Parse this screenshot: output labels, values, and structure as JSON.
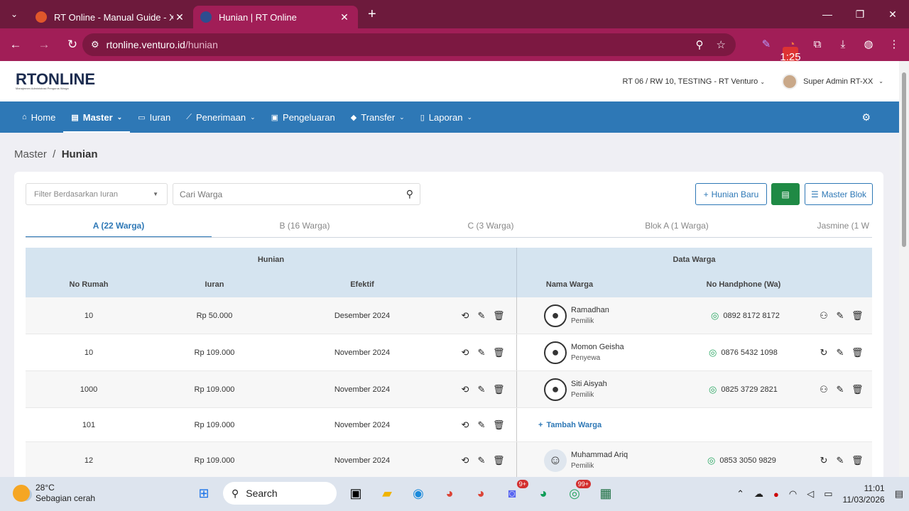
{
  "browser": {
    "tabs": [
      {
        "title": "RT Online - Manual Guide - Xm",
        "active": false
      },
      {
        "title": "Hunian | RT Online",
        "active": true
      }
    ],
    "url_host": "rtonline.venturo.id",
    "url_path": "/hunian",
    "ext_badge": "1:25"
  },
  "app": {
    "logo_main": "RT",
    "logo_on": "ONLINE",
    "logo_sub": "Manajemen Administrasi Pengurus Warga",
    "org_select": "RT 06 / RW 10, TESTING - RT Venturo",
    "user_name": "Super Admin RT-XX"
  },
  "menu": [
    {
      "label": "Home",
      "icon": "home-icon",
      "chev": false
    },
    {
      "label": "Master",
      "icon": "file-icon",
      "chev": true,
      "active": true
    },
    {
      "label": "Iuran",
      "icon": "card-icon",
      "chev": false
    },
    {
      "label": "Penerimaan",
      "icon": "chart-icon",
      "chev": true
    },
    {
      "label": "Pengeluaran",
      "icon": "receipt-icon",
      "chev": false
    },
    {
      "label": "Transfer",
      "icon": "tag-icon",
      "chev": true
    },
    {
      "label": "Laporan",
      "icon": "doc-icon",
      "chev": true
    }
  ],
  "breadcrumb": {
    "parent": "Master",
    "current": "Hunian"
  },
  "toolbar": {
    "filter_placeholder": "Filter Berdasarkan Iuran",
    "search_placeholder": "Cari Warga",
    "new_button": "Hunian Baru",
    "master_blok_button": "Master Blok"
  },
  "blok_tabs": [
    "A (22 Warga)",
    "B (16 Warga)",
    "C (3 Warga)",
    "Blok A (1 Warga)",
    "Jasmine (1 W"
  ],
  "table": {
    "group_hunian": "Hunian",
    "group_warga": "Data Warga",
    "col_no": "No Rumah",
    "col_iuran": "Iuran",
    "col_efektif": "Efektif",
    "col_nama": "Nama Warga",
    "col_hp": "No Handphone (Wa)",
    "add_warga": "Tambah Warga",
    "rows": [
      {
        "no": "10",
        "iuran": "Rp 50.000",
        "efektif": "Desember 2024",
        "nama": "Ramadhan",
        "status": "Pemilik",
        "hp": "0892 8172 8172"
      },
      {
        "no": "10",
        "iuran": "Rp 109.000",
        "efektif": "November 2024",
        "nama": "Momon Geisha",
        "status": "Penyewa",
        "hp": "0876 5432 1098"
      },
      {
        "no": "1000",
        "iuran": "Rp 109.000",
        "efektif": "November 2024",
        "nama": "Siti Aisyah",
        "status": "Pemilik",
        "hp": "0825 3729 2821"
      },
      {
        "no": "101",
        "iuran": "Rp 109.000",
        "efektif": "November 2024",
        "nama": "",
        "status": "",
        "hp": ""
      },
      {
        "no": "12",
        "iuran": "Rp 109.000",
        "efektif": "November 2024",
        "nama": "Muhammad Ariq",
        "status": "Pemilik",
        "hp": "0853 3050 9829"
      }
    ]
  },
  "taskbar": {
    "temp": "28°C",
    "weather": "Sebagian cerah",
    "search": "Search",
    "badge_discord": "9+",
    "badge_whatsapp": "99+",
    "time": "11:01",
    "date": "11/03/2026"
  }
}
